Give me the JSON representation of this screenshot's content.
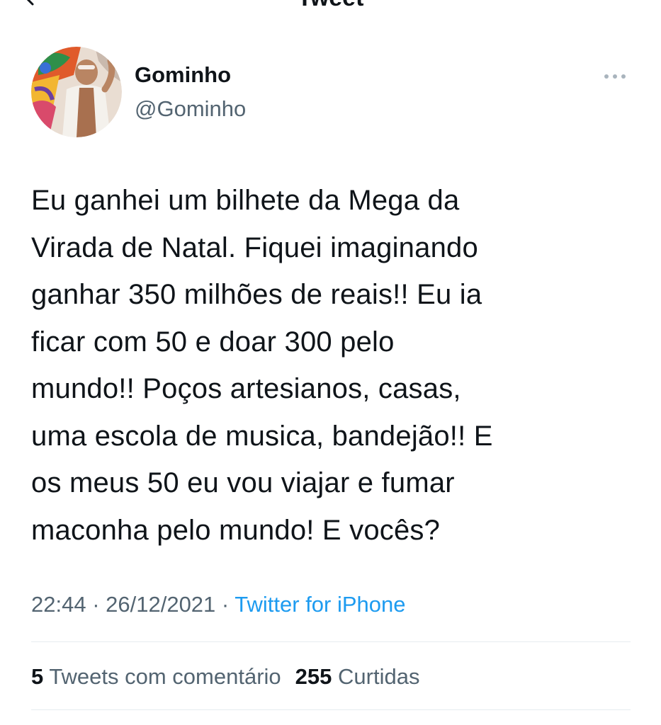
{
  "header": {
    "title": "Tweet",
    "back_icon": "back-arrow-icon"
  },
  "author": {
    "name": "Gominho",
    "handle": "@Gominho"
  },
  "tweet": {
    "text": "Eu ganhei um bilhete da Mega da\nVirada de Natal. Fiquei imaginando\nganhar 350 milhões de reais!! Eu ia\nficar com 50 e doar 300 pelo\nmundo!! Poços artesianos, casas,\numa escola de musica, bandejão!! E\nos meus 50 eu vou viajar e fumar\nmaconha pelo mundo! E vocês?",
    "time": "22:44",
    "separator": " · ",
    "date": "26/12/2021",
    "source": "Twitter for iPhone"
  },
  "stats": {
    "quote_count": "5",
    "quote_label": "Tweets com comentário",
    "like_count": "255",
    "like_label": "Curtidas"
  },
  "colors": {
    "text_primary": "#0f1419",
    "text_secondary": "#536471",
    "link_blue": "#1d9bf0",
    "divider": "#e6ecf0"
  }
}
